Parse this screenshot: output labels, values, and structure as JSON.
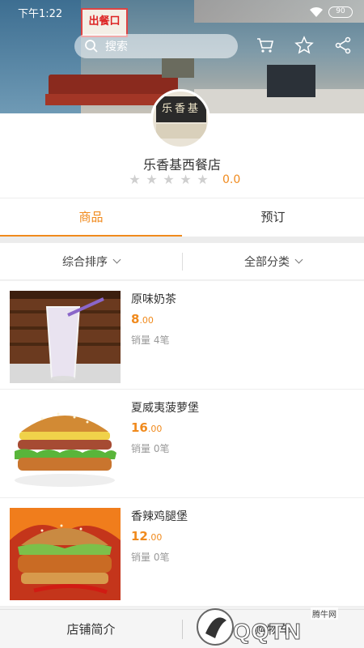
{
  "status": {
    "time": "下午1:22",
    "battery": "90"
  },
  "search": {
    "placeholder": "搜索"
  },
  "shop": {
    "logo_text": "乐香基",
    "name": "乐香基西餐店",
    "score": "0.0",
    "star_count": 5
  },
  "tabs": [
    {
      "label": "商品",
      "active": true
    },
    {
      "label": "预订",
      "active": false
    }
  ],
  "filters": {
    "sort": "综合排序",
    "category": "全部分类"
  },
  "items": [
    {
      "name": "原味奶茶",
      "price_int": "8",
      "price_dec": ".00",
      "sales": "销量 4笔",
      "image": "milk-tea"
    },
    {
      "name": "夏威夷菠萝堡",
      "price_int": "16",
      "price_dec": ".00",
      "sales": "销量 0笔",
      "image": "pineapple-burger"
    },
    {
      "name": "香辣鸡腿堡",
      "price_int": "12",
      "price_dec": ".00",
      "sales": "销量 0笔",
      "image": "spicy-chicken-burger"
    }
  ],
  "bottom": {
    "intro": "店铺简介",
    "cart": "购物车"
  },
  "banner": {
    "sign_text": "出餐口"
  },
  "watermark": {
    "text": "QQTN",
    "site": "腾牛网"
  },
  "colors": {
    "accent": "#f08a1d",
    "star_empty": "#cfcfcf"
  }
}
